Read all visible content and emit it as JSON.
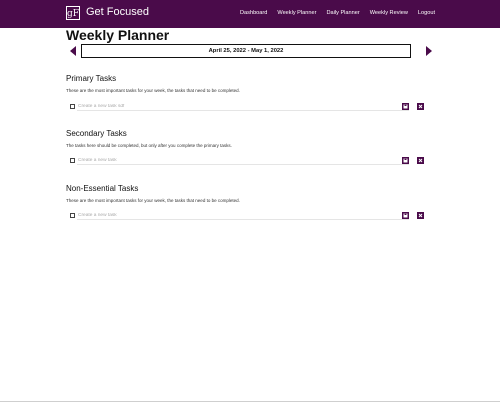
{
  "app": {
    "logo_text": "gF",
    "brand_name": "Get Focused"
  },
  "nav": {
    "items": [
      "Dashboard",
      "Weekly Planner",
      "Daily Planner",
      "Weekly Review",
      "Logout"
    ]
  },
  "page": {
    "title": "Weekly Planner",
    "week_range": "April 25, 2022 - May 1, 2022"
  },
  "sections": [
    {
      "title": "Primary Tasks",
      "description": "These are the most important tasks for your week, the tasks that need to be completed.",
      "task_placeholder": "Create a new task sdf"
    },
    {
      "title": "Secondary Tasks",
      "description": "The tasks here should be completed, but only after you complete the primary tasks.",
      "task_placeholder": "Create a new task"
    },
    {
      "title": "Non-Essential Tasks",
      "description": "These are the most important tasks for your week, the tasks that need to be completed.",
      "task_placeholder": "Create a new task"
    }
  ],
  "colors": {
    "accent": "#4a0b4a"
  },
  "icons": {
    "prev": "chevron-left-icon",
    "next": "chevron-right-icon",
    "save": "save-icon",
    "delete": "delete-icon"
  }
}
